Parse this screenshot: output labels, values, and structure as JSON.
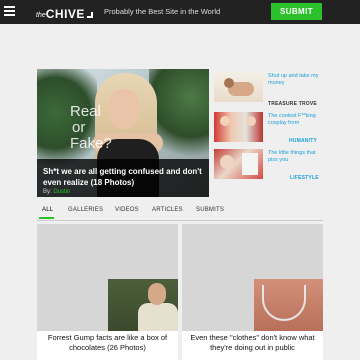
{
  "header": {
    "logo_the": "the",
    "logo_chive": "CHIVE",
    "tagline": "Probably the Best Site in the World",
    "submit_label": "SUBMIT"
  },
  "hero": {
    "overlay_text_line1": "Real",
    "overlay_text_line2": "or",
    "overlay_text_line3": "Fake?",
    "headline": "Sh*t we are all getting confused and don't even realize (18 Photos)",
    "byline_prefix": "By:",
    "author": "Dustin"
  },
  "sidebar": {
    "items": [
      {
        "text": "Shut up and take my money",
        "category": "TREASURE TROVE"
      },
      {
        "text": "The coolest F**king cosplay from",
        "category": "HUMANITY"
      },
      {
        "text": "The little things that piss you",
        "category": "LIFESTYLE"
      }
    ]
  },
  "tabs": [
    "ALL",
    "GALLERIES",
    "VIDEOS",
    "ARTICLES",
    "SUBMITS"
  ],
  "cards": [
    {
      "caption": "Forrest Gump facts are like a box of chocolates (26 Photos)"
    },
    {
      "caption": "Even these \"clothes\" don't know what they're doing out in public"
    }
  ],
  "colors": {
    "accent": "#2cc02c",
    "link": "#1aa0d8",
    "topbar": "#222222"
  }
}
